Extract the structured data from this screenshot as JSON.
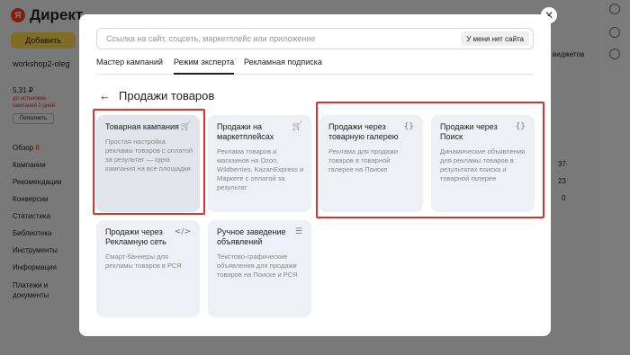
{
  "background": {
    "logo_mark": "Я",
    "logo_text": "Директ",
    "add_button": "Добавить",
    "account": "workshop2-oleg",
    "balance": "5,31 ₽",
    "stop_note": "до остановки кампаний 0 дней",
    "topup": "Пополнить",
    "nav": [
      "Обзор",
      "Кампании",
      "Рекомендации",
      "Конверсии",
      "Статистика",
      "Библиотека",
      "Инструменты",
      "Информация",
      "Платежи и документы"
    ],
    "nav_badge": "8",
    "widgets_label": "виджетов",
    "numbers": [
      "37",
      "23",
      "0"
    ]
  },
  "modal": {
    "search_placeholder": "Ссылка на сайт, соцсеть, маркетплейс или приложение",
    "no_site_button": "У меня нет сайта",
    "tabs": [
      "Мастер кампаний",
      "Режим эксперта",
      "Рекламная подписка"
    ],
    "active_tab": "Режим эксперта",
    "back_arrow": "←",
    "section_title": "Продажи товаров",
    "close": "✕",
    "cards": [
      {
        "title": "Товарная кампания",
        "desc": "Простая настройка рекламы товаров с оплатой за результат — одна кампания на все площадки",
        "icon": "cart-icon",
        "glyph": "🛒"
      },
      {
        "title": "Продажи на маркетплейсах",
        "desc": "Реклама товаров и магазинов на Ozon, Wildberries, KazanExpress и Маркете с оплатой за результат",
        "icon": "cart-icon",
        "glyph": "🛒"
      },
      {
        "title": "Продажи через товарную галерею",
        "desc": "Реклама для продажи товаров в товарной галерее на Поиске",
        "icon": "braces-icon",
        "glyph": "{}"
      },
      {
        "title": "Продажи через Поиск",
        "desc": "Динамические объявления для рекламы товаров в результатах поиска и товарной галерее",
        "icon": "braces-icon",
        "glyph": "{}"
      },
      {
        "title": "Продажи через Рекламную сеть",
        "desc": "Смарт-баннеры для рекламы товаров в РСЯ",
        "icon": "code-icon",
        "glyph": "</>"
      },
      {
        "title": "Ручное заведение объявлений",
        "desc": "Текстово-графические объявления для продажи товаров на Поиске и РСЯ",
        "icon": "list-icon",
        "glyph": "☰"
      }
    ]
  },
  "highlight_color": "#e2302f"
}
